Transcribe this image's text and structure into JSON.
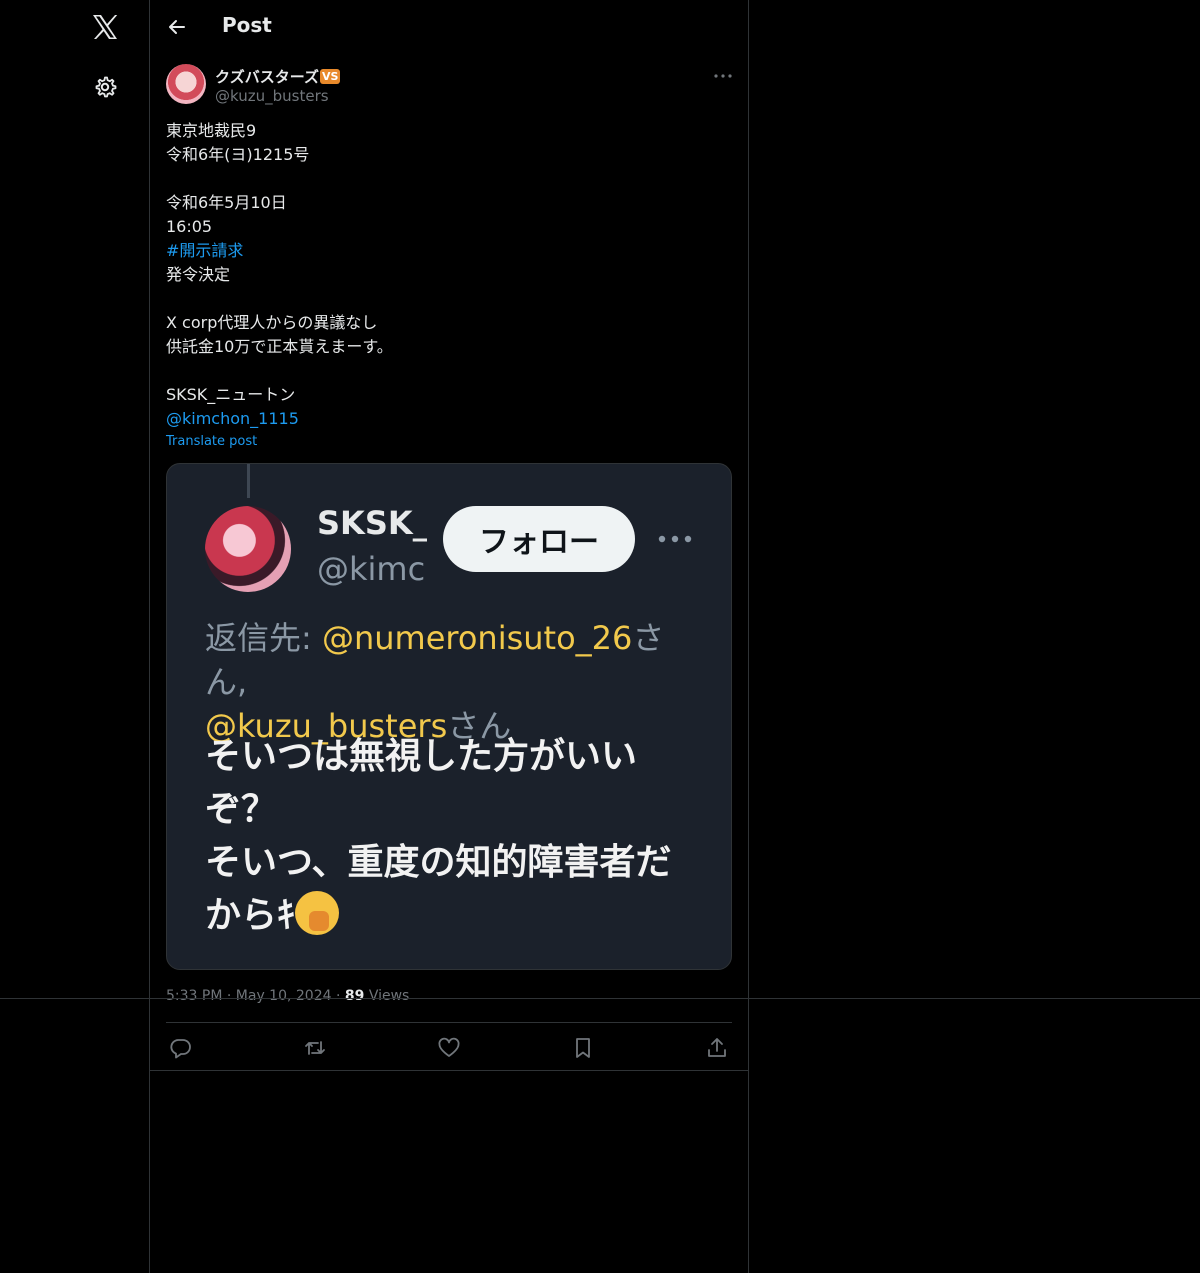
{
  "header": {
    "title": "Post"
  },
  "post": {
    "display_name": "クズバスターズ",
    "badge": "VS",
    "handle": "@kuzu_busters",
    "lines": [
      "東京地裁民9",
      "令和6年(ヨ)1215号",
      "",
      "令和6年5月10日",
      "16:05",
      "#開示請求",
      "発令決定",
      "",
      "X corp代理人からの異議なし",
      "供託金10万で正本貰えまーす。",
      "",
      "SKSK_ニュートン",
      "@kimchon_1115"
    ],
    "translate": "Translate post",
    "time": "5:33 PM",
    "sep": "·",
    "date": "May 10, 2024",
    "views_count": "89",
    "views_label": "Views"
  },
  "embedded": {
    "name": "SKSK_:",
    "handle": "@kimcl",
    "follow_label": "フォロー",
    "reply_prefix": "返信先: ",
    "reply_user1": "@numeronisuto_26",
    "reply_san1": "さん,",
    "reply_user2": "@kuzu_busters",
    "reply_san2": "さん",
    "text_line1": "そいつは無視した方がいい",
    "text_line2": "ぞ？",
    "text_line3": "そいつ、重度の知的障害者だ",
    "text_line4": "からｷ"
  },
  "colors": {
    "link": "#1d9bf0",
    "badge": "#e98a2b",
    "highlight": "#f2c94c"
  }
}
